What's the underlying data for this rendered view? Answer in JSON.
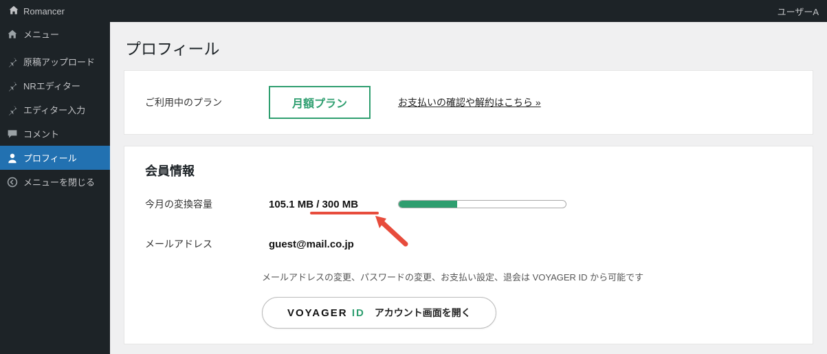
{
  "topbar": {
    "brand": "Romancer",
    "user": "ユーザーA"
  },
  "sidebar": {
    "items": [
      {
        "label": "メニュー",
        "icon": "home"
      },
      {
        "label": "原稿アップロード",
        "icon": "pin"
      },
      {
        "label": "NRエディター",
        "icon": "pin"
      },
      {
        "label": "エディター入力",
        "icon": "pin"
      },
      {
        "label": "コメント",
        "icon": "comment"
      },
      {
        "label": "プロフィール",
        "icon": "person"
      },
      {
        "label": "メニューを閉じる",
        "icon": "collapse"
      }
    ]
  },
  "page": {
    "title": "プロフィール",
    "plan": {
      "label": "ご利用中のプラン",
      "name": "月額プラン",
      "link_text": "お支払いの確認や解約はこちら »"
    },
    "member": {
      "section_title": "会員情報",
      "quota_label": "今月の変換容量",
      "quota_value": "105.1 MB / 300 MB",
      "quota_used": 105.1,
      "quota_total": 300,
      "quota_percent": 35,
      "email_label": "メールアドレス",
      "email_value": "guest@mail.co.jp",
      "note": "メールアドレスの変更、パスワードの変更、お支払い設定、退会は VOYAGER ID から可能です",
      "voyager_logo_main": "VOYAGER",
      "voyager_logo_sub": "ID",
      "voyager_btn_text": "アカウント画面を開く"
    }
  }
}
